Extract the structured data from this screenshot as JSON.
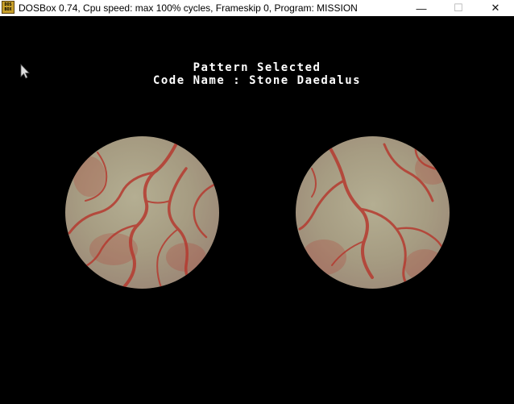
{
  "window": {
    "title": "DOSBox 0.74, Cpu speed: max 100% cycles, Frameskip  0, Program:  MISSION",
    "icon": "dosbox-icon",
    "icon_text_top": "DOS",
    "icon_text_bottom": "BOX",
    "minimize_glyph": "—",
    "maximize_glyph": "☐",
    "close_glyph": "✕"
  },
  "game": {
    "headline": "Pattern Selected",
    "code_name": "Code Name : Stone Daedalus",
    "patterns": [
      {
        "name": "stone-daedalus-pattern-left",
        "base_color": "#a8a286",
        "vein_color": "#b53a30"
      },
      {
        "name": "stone-daedalus-pattern-right",
        "base_color": "#a8a286",
        "vein_color": "#b53a30"
      }
    ]
  }
}
